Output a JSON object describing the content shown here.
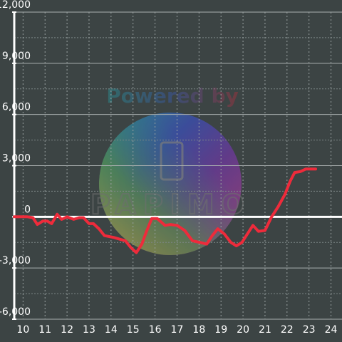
{
  "chart_data": {
    "type": "line",
    "title": "",
    "xlabel": "",
    "ylabel": "",
    "xlim": [
      9.6,
      24.5
    ],
    "ylim": [
      -6000,
      12000
    ],
    "x_ticks": [
      10,
      11,
      12,
      13,
      14,
      15,
      16,
      17,
      18,
      19,
      20,
      21,
      22,
      23,
      24
    ],
    "x_tick_labels": [
      "10",
      "11",
      "12",
      "13",
      "14",
      "15",
      "16",
      "17",
      "18",
      "19",
      "20",
      "21",
      "22",
      "23",
      "24"
    ],
    "y_ticks": [
      -6000,
      -3000,
      0,
      3000,
      6000,
      9000,
      12000
    ],
    "y_tick_labels": [
      "-6,000",
      "-3,000",
      "0",
      "3,000",
      "6,000",
      "9,000",
      "12,000"
    ],
    "grid": true,
    "legend": "none",
    "series": [
      {
        "color": "#ee2b3b",
        "points": [
          [
            9.6,
            0
          ],
          [
            10.2,
            0
          ],
          [
            10.45,
            -50
          ],
          [
            10.65,
            -450
          ],
          [
            10.9,
            -250
          ],
          [
            11.1,
            -250
          ],
          [
            11.3,
            -400
          ],
          [
            11.55,
            150
          ],
          [
            11.75,
            -150
          ],
          [
            12.0,
            0
          ],
          [
            12.3,
            -150
          ],
          [
            12.55,
            -50
          ],
          [
            12.75,
            -50
          ],
          [
            13.0,
            -400
          ],
          [
            13.2,
            -400
          ],
          [
            13.45,
            -700
          ],
          [
            13.7,
            -1100
          ],
          [
            14.1,
            -1200
          ],
          [
            14.65,
            -1400
          ],
          [
            14.9,
            -1800
          ],
          [
            15.15,
            -2100
          ],
          [
            15.4,
            -1600
          ],
          [
            15.6,
            -900
          ],
          [
            15.85,
            -100
          ],
          [
            16.1,
            -100
          ],
          [
            16.45,
            -500
          ],
          [
            16.7,
            -450
          ],
          [
            17.0,
            -500
          ],
          [
            17.35,
            -800
          ],
          [
            17.7,
            -1400
          ],
          [
            18.05,
            -1500
          ],
          [
            18.35,
            -1600
          ],
          [
            18.6,
            -1100
          ],
          [
            18.85,
            -700
          ],
          [
            19.15,
            -1000
          ],
          [
            19.45,
            -1500
          ],
          [
            19.7,
            -1700
          ],
          [
            19.95,
            -1500
          ],
          [
            20.2,
            -1000
          ],
          [
            20.45,
            -500
          ],
          [
            20.7,
            -850
          ],
          [
            21.0,
            -800
          ],
          [
            21.3,
            0
          ],
          [
            21.6,
            600
          ],
          [
            21.9,
            1300
          ],
          [
            22.15,
            2100
          ],
          [
            22.35,
            2600
          ],
          [
            22.6,
            2650
          ],
          [
            22.85,
            2800
          ],
          [
            23.3,
            2800
          ]
        ]
      }
    ],
    "watermark": {
      "text": "Powered by",
      "logo_text": "PAPIMO"
    }
  }
}
